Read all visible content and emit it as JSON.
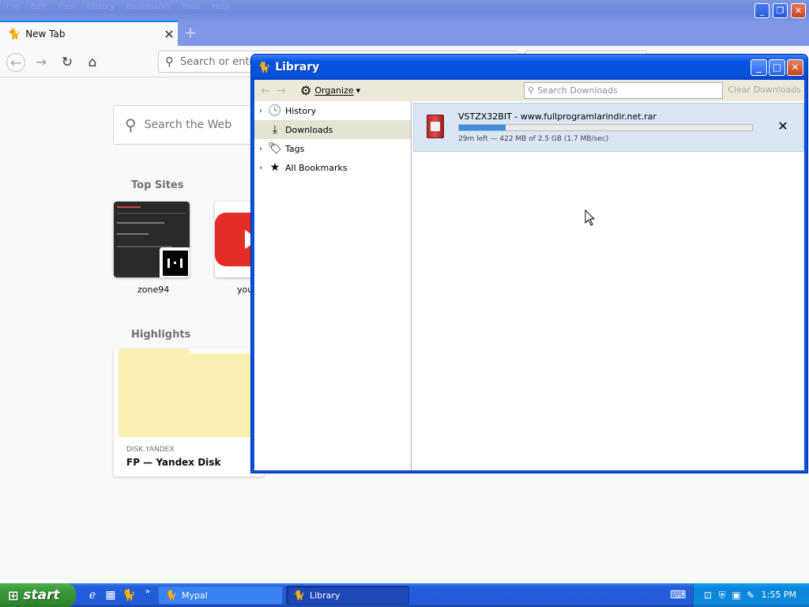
{
  "browser": {
    "menu": [
      "File",
      "Edit",
      "View",
      "History",
      "Bookmarks",
      "Tools",
      "Help"
    ],
    "tab_label": "New Tab",
    "urlbar_placeholder": "Search or ente",
    "web_search_placeholder": "Search the Web",
    "top_sites_heading": "Top Sites",
    "top_sites": [
      {
        "label": "zone94"
      },
      {
        "label": "you"
      }
    ],
    "highlights_heading": "Highlights",
    "highlight": {
      "source": "DISK.YANDEX",
      "title": "FP — Yandex Disk"
    }
  },
  "library": {
    "title": "Library",
    "organize_label": "Organize",
    "search_placeholder": "Search Downloads",
    "clear_label": "Clear Downloads",
    "sidebar": [
      {
        "label": "History",
        "icon": "clock-icon",
        "expandable": true,
        "selected": false
      },
      {
        "label": "Downloads",
        "icon": "download-icon",
        "expandable": false,
        "selected": true
      },
      {
        "label": "Tags",
        "icon": "tag-icon",
        "expandable": true,
        "selected": false
      },
      {
        "label": "All Bookmarks",
        "icon": "star-icon",
        "expandable": true,
        "selected": false
      }
    ],
    "download": {
      "name": "VSTZX32BIT - www.fullprogramlarindir.net.rar",
      "status": "29m left — 422 MB of 2.5 GB (1.7 MB/sec)",
      "progress_percent": 16
    }
  },
  "taskbar": {
    "start_label": "start",
    "tasks": [
      {
        "label": "Mypal"
      },
      {
        "label": "Library"
      }
    ],
    "clock": "1:55 PM"
  },
  "colors": {
    "xp_blue": "#0c4fd8",
    "progress": "#3a8ee8",
    "start_green": "#3a9a3a",
    "selected_row": "#dae6f4"
  }
}
